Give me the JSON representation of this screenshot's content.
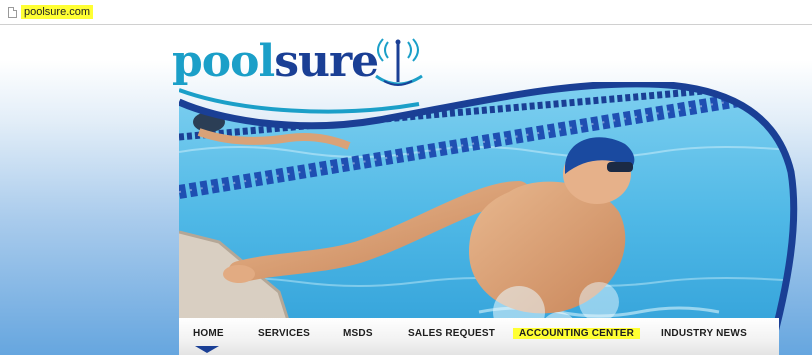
{
  "browser": {
    "url": "poolsure.com"
  },
  "logo": {
    "part1": "pool",
    "part2": "sure",
    "colors": {
      "pool": "#1b9fc8",
      "sure": "#1a3f95"
    }
  },
  "hero": {
    "image_subject": "swimmer in pool with blue cap and goggles, lane rope and second swimmer in background"
  },
  "nav": {
    "items": [
      {
        "label": "HOME",
        "active": true
      },
      {
        "label": "SERVICES"
      },
      {
        "label": "MSDS"
      },
      {
        "label": "SALES REQUEST"
      },
      {
        "label": "ACCOUNTING CENTER",
        "highlighted": true
      },
      {
        "label": "INDUSTRY NEWS"
      }
    ]
  },
  "colors": {
    "accent_navy": "#1a3f95",
    "accent_teal": "#1b9fc8",
    "highlight": "#ffff33"
  }
}
